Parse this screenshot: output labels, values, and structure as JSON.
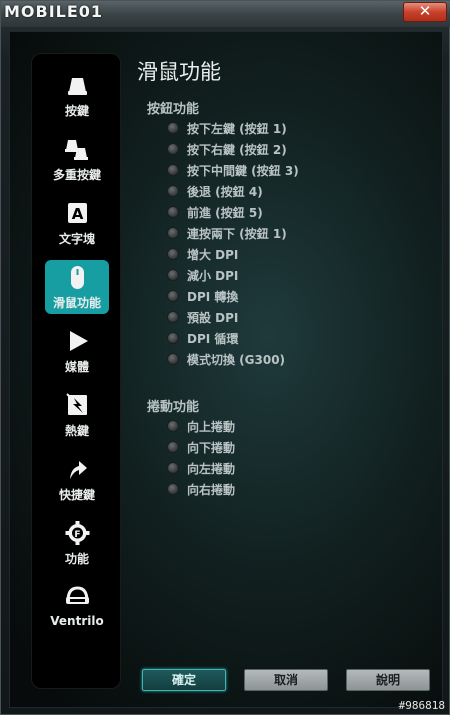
{
  "titlebar": {
    "logo_text": "MOBILE01",
    "close_label": "✕"
  },
  "sidebar": {
    "items": [
      {
        "label": "按鍵",
        "icon": "key-icon",
        "active": false
      },
      {
        "label": "多重按鍵",
        "icon": "multi-key-icon",
        "active": false
      },
      {
        "label": "文字塊",
        "icon": "text-block-icon",
        "active": false
      },
      {
        "label": "滑鼠功能",
        "icon": "mouse-icon",
        "active": true
      },
      {
        "label": "媒體",
        "icon": "play-icon",
        "active": false
      },
      {
        "label": "熱鍵",
        "icon": "hotkey-icon",
        "active": false
      },
      {
        "label": "快捷鍵",
        "icon": "shortcut-arrow-icon",
        "active": false
      },
      {
        "label": "功能",
        "icon": "function-gear-icon",
        "active": false
      },
      {
        "label": "Ventrilo",
        "icon": "headset-icon",
        "active": false
      }
    ]
  },
  "main": {
    "title": "滑鼠功能",
    "button_section": {
      "title": "按鈕功能",
      "options": [
        "按下左鍵 (按鈕 1)",
        "按下右鍵 (按鈕 2)",
        "按下中間鍵 (按鈕 3)",
        "後退 (按鈕 4)",
        "前進 (按鈕 5)",
        "連按兩下 (按鈕 1)",
        "增大 DPI",
        "減小 DPI",
        "DPI 轉換",
        "預設 DPI",
        "DPI 循環",
        "模式切換 (G300)"
      ]
    },
    "scroll_section": {
      "title": "捲動功能",
      "options": [
        "向上捲動",
        "向下捲動",
        "向左捲動",
        "向右捲動"
      ]
    }
  },
  "footer": {
    "ok_label": "確定",
    "cancel_label": "取消",
    "help_label": "說明"
  },
  "watermark": "#986818",
  "colors": {
    "accent": "#169ea3",
    "background": "#0c1215"
  }
}
